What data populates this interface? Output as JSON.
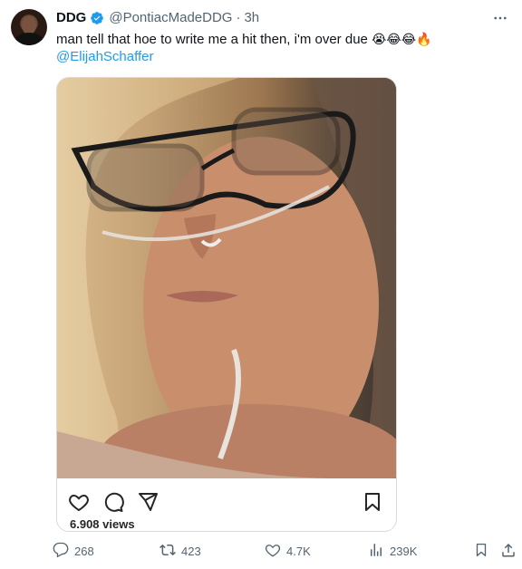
{
  "tweet": {
    "display_name": "DDG",
    "handle": "@PontiacMadeDDG",
    "separator": "·",
    "time": "3h",
    "text": "man tell that hoe to write me a hit then, i'm over due",
    "emojis": "😭😂😂🔥",
    "mention": "@ElijahSchaffer",
    "verified": true
  },
  "embedded_post": {
    "views": "6.908 views",
    "icons": [
      "heart-icon",
      "comment-icon",
      "share-icon",
      "bookmark-icon"
    ]
  },
  "actions": {
    "replies": "268",
    "retweets": "423",
    "likes": "4.7K",
    "views": "239K"
  },
  "colors": {
    "accent": "#1d9bf0",
    "muted": "#536471",
    "text": "#0f1419"
  }
}
